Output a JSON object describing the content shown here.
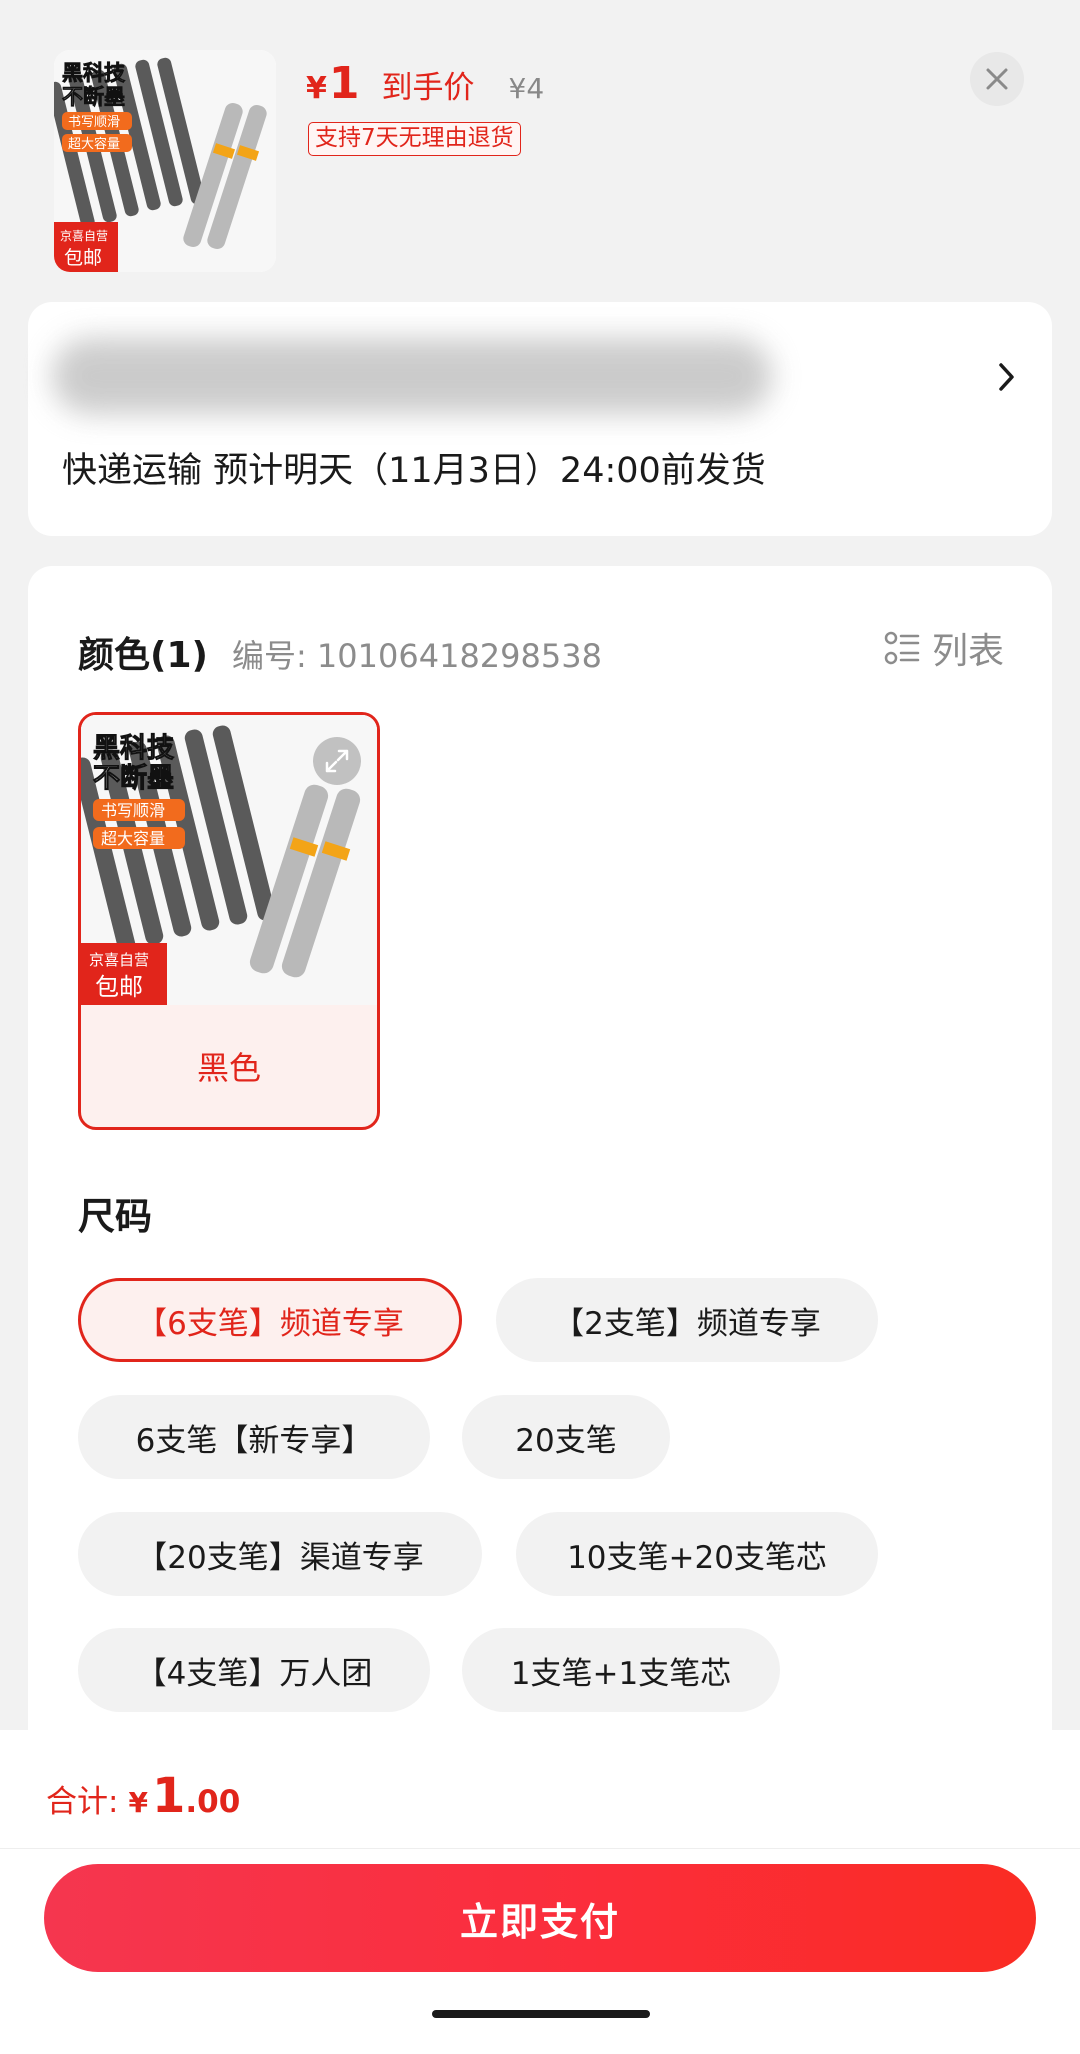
{
  "header": {
    "price_yen": "¥",
    "price_value": "1",
    "price_label": "到手价",
    "original_price": "¥4",
    "return_policy": "支持7天无理由退货"
  },
  "product_image": {
    "line1": "黑科技",
    "line2": "不断墨",
    "badge1": "书写顺滑",
    "badge2": "超大容量",
    "store_tag": "京喜自营",
    "shipping_tag": "包邮"
  },
  "address": {
    "delivery": "快递运输 预计明天（11月3日）24:00前发货"
  },
  "color_section": {
    "title": "颜色(1)",
    "sku": "编号: 10106418298538",
    "list_label": "列表",
    "selected_color": "黑色"
  },
  "size_section": {
    "title": "尺码",
    "options": [
      "【6支笔】频道专享",
      "【2支笔】频道专享",
      "6支笔【新专享】",
      "20支笔",
      "【20支笔】渠道专享",
      "10支笔+20支笔芯",
      "【4支笔】万人团",
      "1支笔+1支笔芯"
    ],
    "selected": "【6支笔】频道专享"
  },
  "footer": {
    "total_label": "合计:",
    "total_yen": "¥",
    "total_int": "1",
    "total_dec": ".00",
    "pay_label": "立即支付"
  },
  "colors": {
    "accent": "#e1251b",
    "pay_gradient_start": "#f5364f",
    "pay_gradient_end": "#fa2c23"
  }
}
